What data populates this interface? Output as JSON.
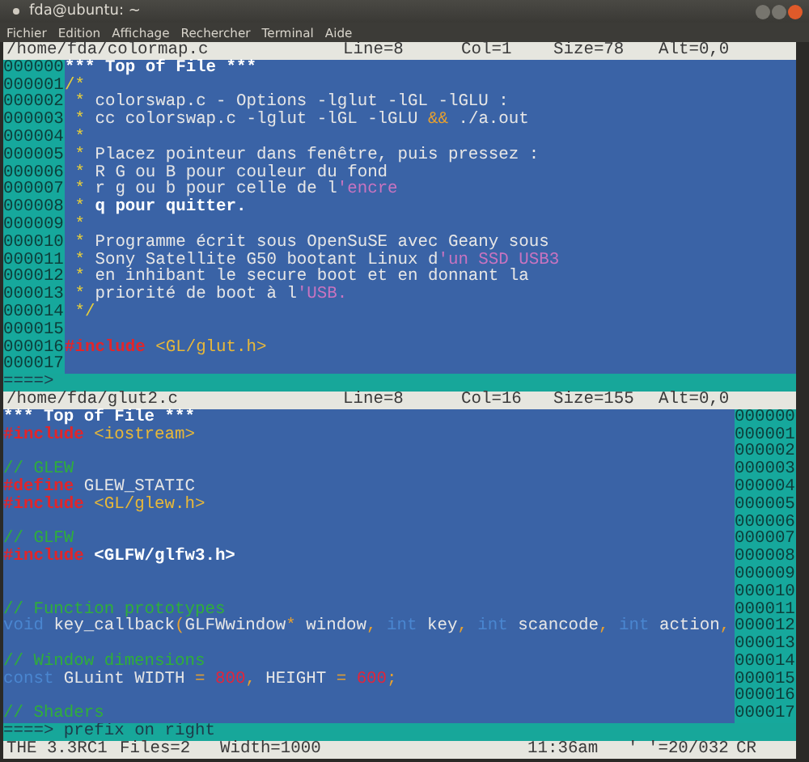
{
  "window": {
    "title": "fda@ubuntu: ~"
  },
  "menu": [
    "Fichier",
    "Edition",
    "Affichage",
    "Rechercher",
    "Terminal",
    "Aide"
  ],
  "panes": [
    {
      "prefix_right": false,
      "info": [
        "/home/fda/colormap.c",
        "Line=8",
        "Col=1",
        "Size=78",
        "Alt=0,0"
      ],
      "lines": [
        {
          "prefix": "000000",
          "segments": [
            {
              "text": "*** Top of File ***",
              "kind": "marker"
            }
          ]
        },
        {
          "prefix": "000001",
          "segments": [
            {
              "text": "/*",
              "kind": "star"
            }
          ]
        },
        {
          "prefix": "000002",
          "segments": [
            {
              "text": " * ",
              "kind": "star"
            },
            {
              "text": "colorswap.c - Options -lglut -lGL -lGLU :",
              "kind": "text"
            }
          ]
        },
        {
          "prefix": "000003",
          "segments": [
            {
              "text": " * ",
              "kind": "star"
            },
            {
              "text": "cc colorswap.c -lglut -lGL -lGLU ",
              "kind": "text"
            },
            {
              "text": "&&",
              "kind": "op"
            },
            {
              "text": " ./a.out",
              "kind": "text"
            }
          ]
        },
        {
          "prefix": "000004",
          "segments": [
            {
              "text": " *",
              "kind": "star"
            }
          ]
        },
        {
          "prefix": "000005",
          "segments": [
            {
              "text": " * ",
              "kind": "star"
            },
            {
              "text": "Placez pointeur dans fenêtre, puis pressez :",
              "kind": "text"
            }
          ]
        },
        {
          "prefix": "000006",
          "segments": [
            {
              "text": " * ",
              "kind": "star"
            },
            {
              "text": "R G ou B pour couleur du fond",
              "kind": "text"
            }
          ]
        },
        {
          "prefix": "000007",
          "segments": [
            {
              "text": " * ",
              "kind": "star"
            },
            {
              "text": "r g ou b pour celle de l",
              "kind": "text"
            },
            {
              "text": "'encre",
              "kind": "string"
            }
          ]
        },
        {
          "prefix": "000008",
          "segments": [
            {
              "text": " * ",
              "kind": "star"
            },
            {
              "text": "q pour quitter.",
              "kind": "bold"
            }
          ]
        },
        {
          "prefix": "000009",
          "segments": [
            {
              "text": " *",
              "kind": "star"
            }
          ]
        },
        {
          "prefix": "000010",
          "segments": [
            {
              "text": " * ",
              "kind": "star"
            },
            {
              "text": "Programme écrit sous OpenSuSE avec Geany sous",
              "kind": "text"
            }
          ]
        },
        {
          "prefix": "000011",
          "segments": [
            {
              "text": " * ",
              "kind": "star"
            },
            {
              "text": "Sony Satellite G50 bootant Linux d",
              "kind": "text"
            },
            {
              "text": "'un SSD USB3",
              "kind": "string"
            }
          ]
        },
        {
          "prefix": "000012",
          "segments": [
            {
              "text": " * ",
              "kind": "star"
            },
            {
              "text": "en inhibant le secure boot et en donnant la",
              "kind": "text"
            }
          ]
        },
        {
          "prefix": "000013",
          "segments": [
            {
              "text": " * ",
              "kind": "star"
            },
            {
              "text": "priorité de boot à l",
              "kind": "text"
            },
            {
              "text": "'USB.",
              "kind": "string"
            }
          ]
        },
        {
          "prefix": "000014",
          "segments": [
            {
              "text": " */",
              "kind": "star"
            }
          ]
        },
        {
          "prefix": "000015"
        },
        {
          "prefix": "000016",
          "segments": [
            {
              "text": "#include",
              "kind": "directive"
            },
            {
              "text": " <GL/glut.h>",
              "kind": "header"
            }
          ]
        },
        {
          "prefix": "000017"
        }
      ],
      "command": {
        "arrow": "====>"
      }
    },
    {
      "prefix_right": true,
      "info": [
        "/home/fda/glut2.c",
        "Line=8",
        "Col=16",
        "Size=155",
        "Alt=0,0"
      ],
      "lines": [
        {
          "prefix": "000000",
          "segments": [
            {
              "text": "*** Top of File ***",
              "kind": "marker"
            }
          ]
        },
        {
          "prefix": "000001",
          "segments": [
            {
              "text": "#include",
              "kind": "directive"
            },
            {
              "text": " <iostream>",
              "kind": "header"
            }
          ]
        },
        {
          "prefix": "000002"
        },
        {
          "prefix": "000003",
          "segments": [
            {
              "text": "// GLEW",
              "kind": "comment"
            }
          ]
        },
        {
          "prefix": "000004",
          "segments": [
            {
              "text": "#define",
              "kind": "directive"
            },
            {
              "text": " GLEW_STATIC",
              "kind": "text"
            }
          ]
        },
        {
          "prefix": "000005",
          "segments": [
            {
              "text": "#include",
              "kind": "directive"
            },
            {
              "text": " <GL/glew.h>",
              "kind": "header"
            }
          ]
        },
        {
          "prefix": "000006"
        },
        {
          "prefix": "000007",
          "segments": [
            {
              "text": "// GLFW",
              "kind": "comment"
            }
          ]
        },
        {
          "prefix": "000008",
          "segments": [
            {
              "text": "#include",
              "kind": "directive"
            },
            {
              "text": " <GLFW/glfw3.h>",
              "kind": "bold"
            }
          ]
        },
        {
          "prefix": "000009"
        },
        {
          "prefix": "000010"
        },
        {
          "prefix": "000011",
          "segments": [
            {
              "text": "// Function prototypes",
              "kind": "comment"
            }
          ]
        },
        {
          "prefix": "000012",
          "segments": [
            {
              "text": "void",
              "kind": "type"
            },
            {
              "text": " key_callback",
              "kind": "text"
            },
            {
              "text": "(",
              "kind": "op"
            },
            {
              "text": "GLFWwindow",
              "kind": "text"
            },
            {
              "text": "*",
              "kind": "op"
            },
            {
              "text": " window",
              "kind": "text"
            },
            {
              "text": ",",
              "kind": "op"
            },
            {
              "text": " int",
              "kind": "type"
            },
            {
              "text": " key",
              "kind": "text"
            },
            {
              "text": ",",
              "kind": "op"
            },
            {
              "text": " int",
              "kind": "type"
            },
            {
              "text": " scancode",
              "kind": "text"
            },
            {
              "text": ",",
              "kind": "op"
            },
            {
              "text": " int",
              "kind": "type"
            },
            {
              "text": " action",
              "kind": "text"
            },
            {
              "text": ",",
              "kind": "op"
            }
          ]
        },
        {
          "prefix": "000013"
        },
        {
          "prefix": "000014",
          "segments": [
            {
              "text": "// Window dimensions",
              "kind": "comment"
            }
          ]
        },
        {
          "prefix": "000015",
          "segments": [
            {
              "text": "const",
              "kind": "type"
            },
            {
              "text": " GLuint WIDTH ",
              "kind": "text"
            },
            {
              "text": "=",
              "kind": "op"
            },
            {
              "text": " 800",
              "kind": "number"
            },
            {
              "text": ",",
              "kind": "op"
            },
            {
              "text": " HEIGHT ",
              "kind": "text"
            },
            {
              "text": "=",
              "kind": "op"
            },
            {
              "text": " 600",
              "kind": "number"
            },
            {
              "text": ";",
              "kind": "op"
            }
          ]
        },
        {
          "prefix": "000016"
        },
        {
          "prefix": "000017",
          "segments": [
            {
              "text": "// Shaders",
              "kind": "comment"
            }
          ]
        }
      ],
      "command": {
        "arrow": "====>",
        "text": "prefix on right"
      }
    }
  ],
  "status": [
    "THE 3.3RC1",
    "Files=2",
    "Width=1000",
    "11:36am",
    "' '=20/032",
    "CR"
  ]
}
